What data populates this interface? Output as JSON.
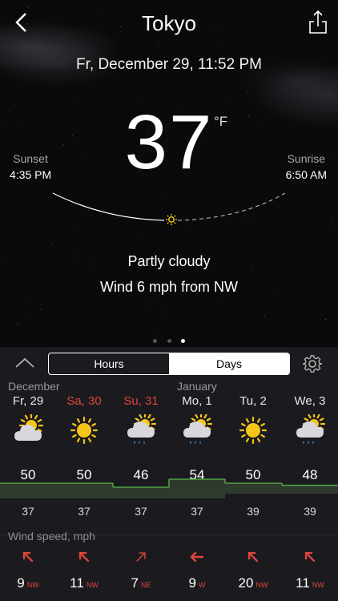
{
  "header": {
    "city": "Tokyo",
    "back_icon": "chevron-left-icon",
    "share_icon": "share-icon"
  },
  "current": {
    "datetime": "Fr, December 29, 11:52 PM",
    "temperature": "37",
    "unit": "°F",
    "sunset_label": "Sunset",
    "sunset_time": "4:35 PM",
    "sunrise_label": "Sunrise",
    "sunrise_time": "6:50 AM",
    "condition": "Partly cloudy",
    "wind": "Wind 6 mph from NW"
  },
  "pager": {
    "count": 3,
    "active_index": 2
  },
  "forecast": {
    "tabs": [
      {
        "label": "Hours",
        "selected": false
      },
      {
        "label": "Days",
        "selected": true
      }
    ],
    "months": [
      "December",
      "January"
    ],
    "days": [
      {
        "name": "Fr, 29",
        "weekend": false,
        "icon": "partly-cloudy-icon",
        "high": "50",
        "low": "37",
        "wind_speed": "9",
        "wind_dir": "NW"
      },
      {
        "name": "Sa, 30",
        "weekend": true,
        "icon": "sunny-icon",
        "high": "50",
        "low": "37",
        "wind_speed": "11",
        "wind_dir": "NW"
      },
      {
        "name": "Su, 31",
        "weekend": true,
        "icon": "rain-icon",
        "high": "46",
        "low": "37",
        "wind_speed": "7",
        "wind_dir": "NE"
      },
      {
        "name": "Mo, 1",
        "weekend": false,
        "icon": "rain-icon",
        "high": "54",
        "low": "37",
        "wind_speed": "9",
        "wind_dir": "W"
      },
      {
        "name": "Tu, 2",
        "weekend": false,
        "icon": "sunny-icon",
        "high": "50",
        "low": "39",
        "wind_speed": "20",
        "wind_dir": "NW"
      },
      {
        "name": "We, 3",
        "weekend": false,
        "icon": "rain-icon",
        "high": "48",
        "low": "39",
        "wind_speed": "11",
        "wind_dir": "NW"
      }
    ],
    "wind_label": "Wind speed, mph"
  },
  "colors": {
    "accent_red": "#e0453c",
    "chart_line": "#5ab54a",
    "sun_yellow": "#f5c518"
  }
}
